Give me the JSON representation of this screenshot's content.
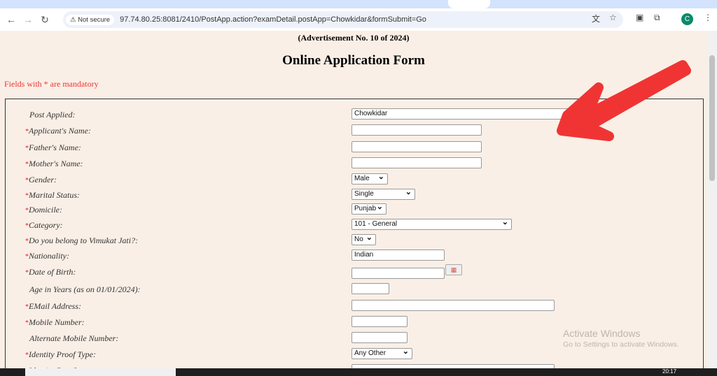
{
  "browser": {
    "security_label": "Not secure",
    "url": "97.74.80.25:8081/2410/PostApp.action?examDetail.postApp=Chowkidar&formSubmit=Go",
    "profile_initial": "C"
  },
  "page": {
    "advertisement": "(Advertisement No. 10 of 2024)",
    "title": "Online Application Form",
    "mandatory_note": "Fields with * are mandatory"
  },
  "form": {
    "rows": [
      {
        "label": "Post Applied:",
        "required": false,
        "type": "text",
        "value": "Chowkidar"
      },
      {
        "label": "Applicant's Name:",
        "required": true,
        "type": "text",
        "value": ""
      },
      {
        "label": "Father's Name:",
        "required": true,
        "type": "text",
        "value": ""
      },
      {
        "label": "Mother's Name:",
        "required": true,
        "type": "text",
        "value": ""
      },
      {
        "label": "Gender:",
        "required": true,
        "type": "select",
        "value": "Male"
      },
      {
        "label": "Marital Status:",
        "required": true,
        "type": "select",
        "value": "Single"
      },
      {
        "label": "Domicile:",
        "required": true,
        "type": "select",
        "value": "Punjab"
      },
      {
        "label": "Category:",
        "required": true,
        "type": "select",
        "value": "101 - General"
      },
      {
        "label": "Do you belong to Vimukat Jati?:",
        "required": true,
        "type": "select",
        "value": "No"
      },
      {
        "label": "Nationality:",
        "required": true,
        "type": "text",
        "value": "Indian"
      },
      {
        "label": "Date of Birth:",
        "required": true,
        "type": "date",
        "value": ""
      },
      {
        "label": "Age in Years (as on 01/01/2024):",
        "required": false,
        "type": "text",
        "value": ""
      },
      {
        "label": "EMail Address:",
        "required": true,
        "type": "text",
        "value": ""
      },
      {
        "label": "Mobile Number:",
        "required": true,
        "type": "text",
        "value": ""
      },
      {
        "label": "Alternate Mobile Number:",
        "required": false,
        "type": "text",
        "value": ""
      },
      {
        "label": "Identity Proof Type:",
        "required": true,
        "type": "select",
        "value": "Any Other"
      },
      {
        "label": "Identity Proof:",
        "required": true,
        "type": "text",
        "value": ""
      }
    ]
  },
  "watermark": {
    "line1": "Activate Windows",
    "line2": "Go to Settings to activate Windows."
  },
  "taskbar": {
    "time": "20:17"
  },
  "colors": {
    "page_bg": "#faefe6",
    "required": "#e22222",
    "annotation_arrow": "#f03434"
  }
}
